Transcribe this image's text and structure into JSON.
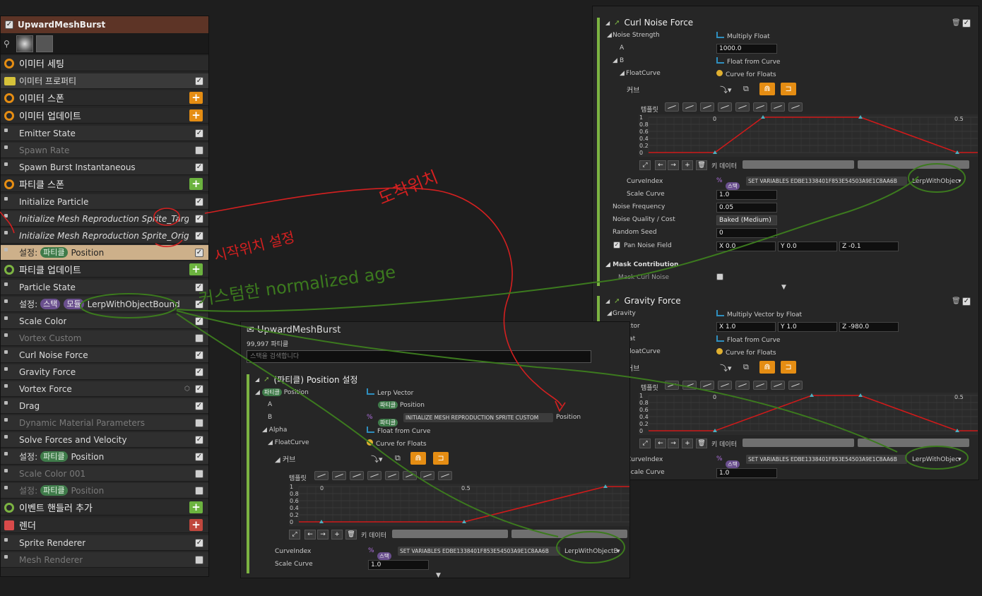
{
  "stack": {
    "title": "UpwardMeshBurst",
    "rows": [
      {
        "label": "이미터 세팅",
        "kind": "header"
      },
      {
        "label": "이미터 프로퍼티",
        "kind": "item"
      },
      {
        "label": "이미터 스폰",
        "kind": "header"
      },
      {
        "label": "이미터 업데이트",
        "kind": "header"
      },
      {
        "label": "Emitter State",
        "kind": "item"
      },
      {
        "label": "Spawn Rate",
        "kind": "item"
      },
      {
        "label": "Spawn Burst Instantaneous",
        "kind": "item"
      },
      {
        "label": "파티클 스폰",
        "kind": "header"
      },
      {
        "label": "Initialize Particle",
        "kind": "item"
      },
      {
        "label": "Initialize Mesh Reproduction Sprite_Target",
        "kind": "item"
      },
      {
        "label": "Initialize Mesh Reproduction Sprite_Origine",
        "kind": "item"
      },
      {
        "label": "Position",
        "prefix": "설정:",
        "pill": "파티클",
        "kind": "item"
      },
      {
        "label": "파티클 업데이트",
        "kind": "header"
      },
      {
        "label": "Particle State",
        "kind": "item"
      },
      {
        "label": "LerpWithObjectBound",
        "prefix": "설정:",
        "pill": "스택",
        "pill2": "모듈",
        "kind": "item"
      },
      {
        "label": "Scale Color",
        "kind": "item"
      },
      {
        "label": "Vortex Custom",
        "kind": "item"
      },
      {
        "label": "Curl Noise Force",
        "kind": "item"
      },
      {
        "label": "Gravity Force",
        "kind": "item"
      },
      {
        "label": "Vortex Force",
        "kind": "item"
      },
      {
        "label": "Drag",
        "kind": "item"
      },
      {
        "label": "Dynamic Material Parameters",
        "kind": "item"
      },
      {
        "label": "Solve Forces and Velocity",
        "kind": "item"
      },
      {
        "label": "Position",
        "prefix": "설정:",
        "pill": "파티클",
        "kind": "item"
      },
      {
        "label": "Scale Color 001",
        "kind": "item"
      },
      {
        "label": "Position",
        "prefix": "설정:",
        "pill": "파티클",
        "kind": "item"
      },
      {
        "label": "이벤트 핸들러 추가",
        "kind": "header"
      },
      {
        "label": "렌더",
        "kind": "header"
      },
      {
        "label": "Sprite Renderer",
        "kind": "item"
      },
      {
        "label": "Mesh Renderer",
        "kind": "item"
      }
    ]
  },
  "curl": {
    "title": "Curl Noise Force",
    "noise_strength": "Noise Strength",
    "multiply_float": "Multiply Float",
    "a_label": "A",
    "a_value": "1000.0",
    "b_label": "B",
    "float_from_curve": "Float from Curve",
    "floatcurve_label": "FloatCurve",
    "curve_for_floats": "Curve for Floats",
    "curve_label": "커브",
    "template_label": "템플릿",
    "key_data_label": "키 데이터",
    "curveindex_label": "CurveIndex",
    "curveindex_pill": "스택",
    "curveindex_setvar": "SET VARIABLES EDBE1338401F853E54503A9E1C8AA6B",
    "curveindex_value": "LerpWithObjec",
    "scale_curve_label": "Scale Curve",
    "scale_curve_value": "1.0",
    "noise_freq_label": "Noise Frequency",
    "noise_freq_value": "0.05",
    "noise_quality_label": "Noise Quality / Cost",
    "noise_quality_value": "Baked (Medium)",
    "random_seed_label": "Random Seed",
    "random_seed_value": "0",
    "pan_label": "Pan Noise Field",
    "pan_x": "X 0.0",
    "pan_y": "Y 0.0",
    "pan_z": "Z -0.1",
    "mask_label": "Mask Contribution",
    "mask_curl_label": "Mask Curl Noise",
    "axis_ticks_y": [
      "1",
      "0.8",
      "0.6",
      "0.4",
      "0.2",
      "0"
    ],
    "axis_ticks_x": [
      "0",
      "0.5"
    ]
  },
  "gravity": {
    "title": "Gravity Force",
    "gravity_label": "Gravity",
    "multiply_vector": "Multiply Vector by Float",
    "vector_label": "Vector",
    "vx": "X 1.0",
    "vy": "Y 1.0",
    "vz": "Z -980.0",
    "float_label": "Float",
    "float_from_curve": "Float from Curve",
    "floatcurve_label": "FloatCurve",
    "curve_for_floats": "Curve for Floats",
    "curve_label": "커브",
    "template_label": "템플릿",
    "key_data_label": "키 데이터",
    "curveindex_label": "CurveIndex",
    "curveindex_pill": "스택",
    "curveindex_setvar": "SET VARIABLES EDBE1338401F853E54503A9E1C8AA6B",
    "curveindex_value": "LerpWithObjec",
    "scale_curve_label": "Scale Curve",
    "scale_curve_value": "1.0",
    "axis_ticks_y": [
      "1",
      "0.8",
      "0.6",
      "0.4",
      "0.2",
      "0"
    ],
    "axis_ticks_x": [
      "0",
      "0.5"
    ]
  },
  "center": {
    "title": "UpwardMeshBurst",
    "count": "99,997 파티클",
    "search_placeholder": "스택을 검색합니다",
    "section_title": "(파티클) Position 설정",
    "pos_pill": "파티클",
    "pos_label": "Position",
    "lerp_vector": "Lerp Vector",
    "a_label": "A",
    "a_pill": "파티클",
    "a_value": "Position",
    "b_label": "B",
    "b_pill": "파티클",
    "b_setvar": "INITIALIZE MESH REPRODUCTION SPRITE CUSTOM",
    "b_value": "Position",
    "alpha_label": "Alpha",
    "float_from_curve": "Float from Curve",
    "floatcurve_label": "FloatCurve",
    "curve_for_floats": "Curve for Floats",
    "curve_label": "커브",
    "template_label": "템플릿",
    "key_data_label": "키 데이터",
    "curveindex_label": "CurveIndex",
    "curveindex_pill": "스택",
    "curveindex_setvar": "SET VARIABLES EDBE1338401F853E54503A9E1C8AA6B",
    "curveindex_value": "LerpWithObjectB",
    "scale_curve_label": "Scale Curve",
    "scale_curve_value": "1.0",
    "axis_ticks_y": [
      "1",
      "0.8",
      "0.6",
      "0.4",
      "0.2",
      "0"
    ],
    "axis_ticks_x": [
      "0",
      "0.5"
    ]
  },
  "annotations": {
    "red_text_1": "도착위치",
    "red_text_2": "시작위치 설정",
    "green_text": "커스텀한 normalized age"
  },
  "colors": {
    "accent_orange": "#e58d13",
    "curve_red": "#d01a1a",
    "annotation_red": "#d42020",
    "annotation_green": "#3c7a1e",
    "section_green": "#7cb342"
  }
}
